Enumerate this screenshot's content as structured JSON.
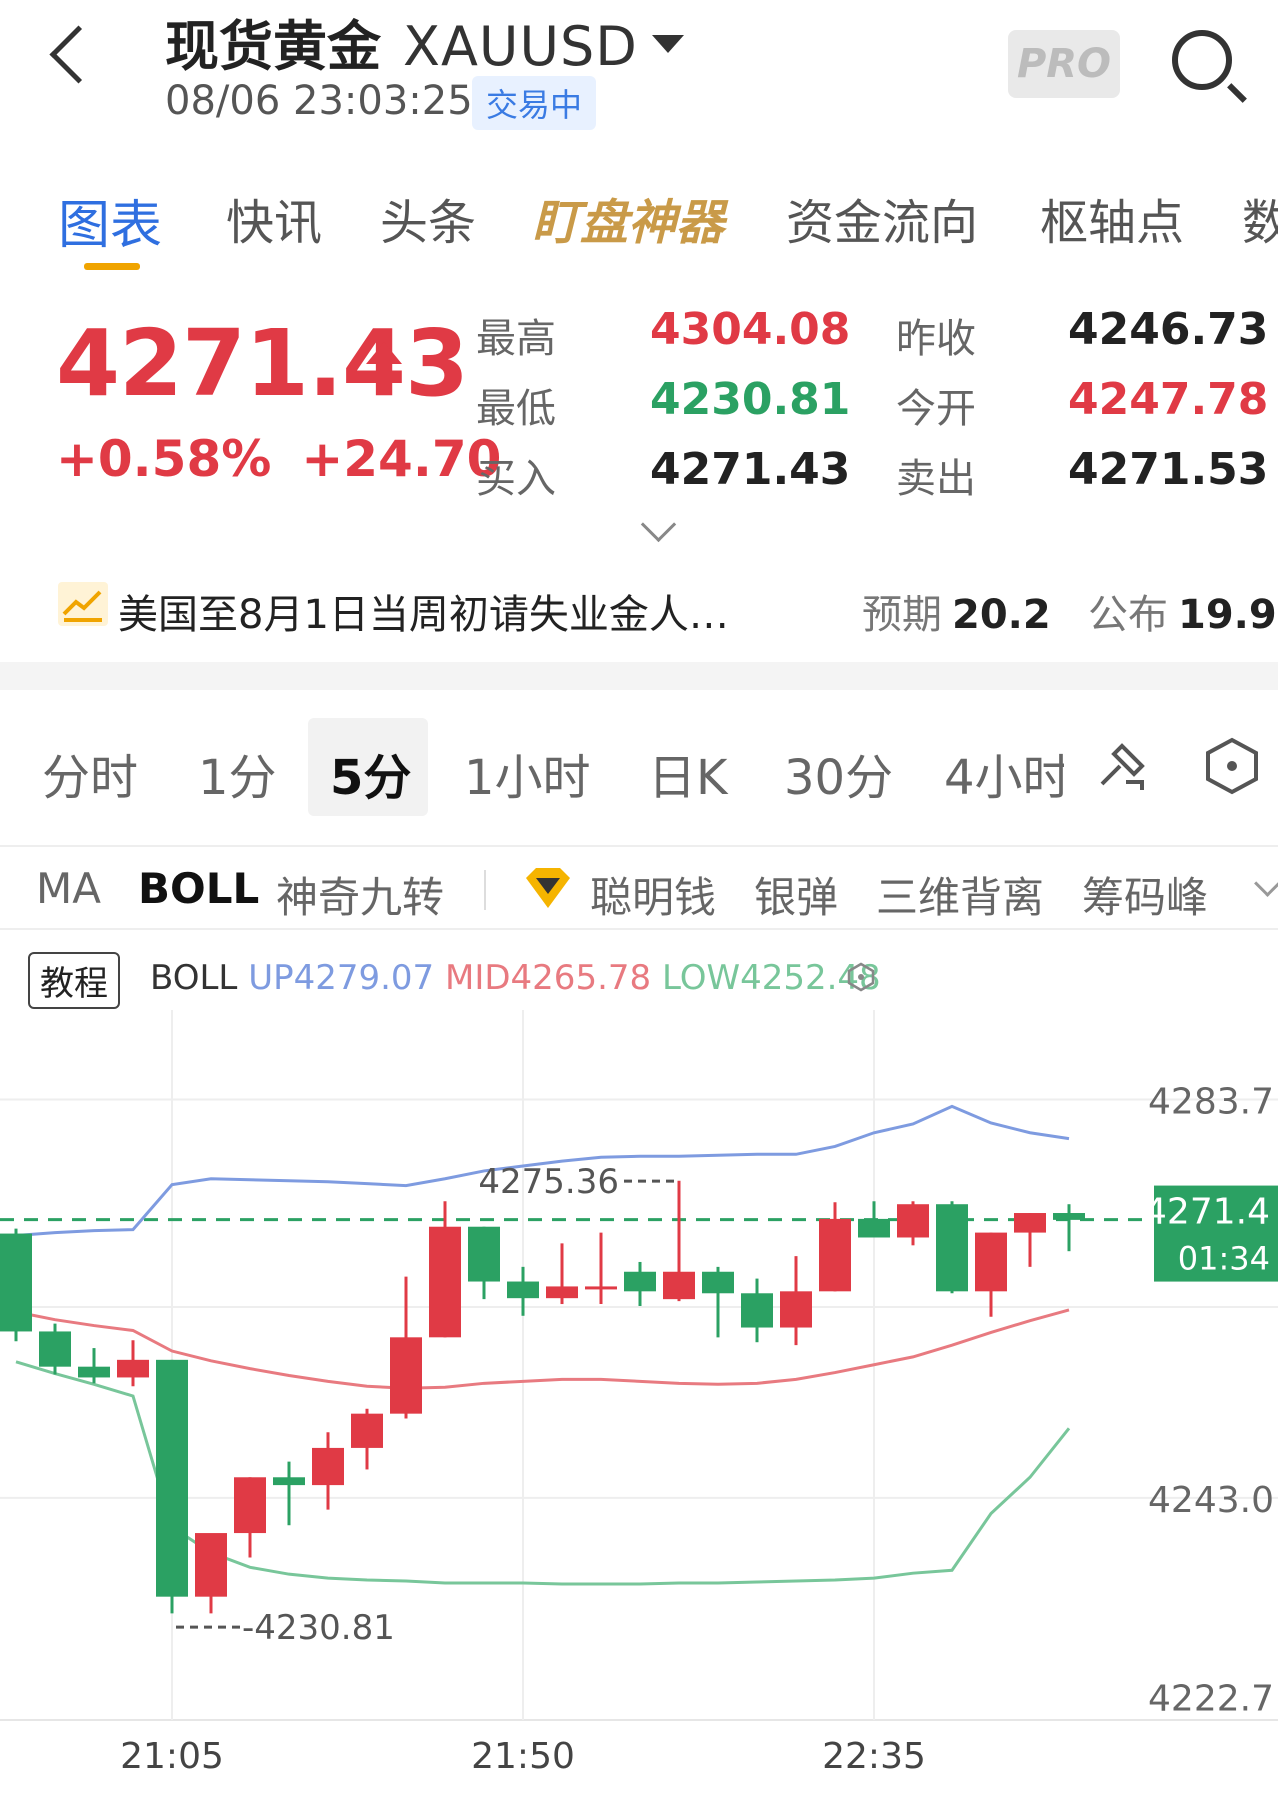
{
  "header": {
    "title": "现货黄金",
    "code": "XAUUSD",
    "datetime": "08/06 23:03:25",
    "status": "交易中",
    "pro_label": "PRO"
  },
  "tabs": [
    {
      "label": "图表",
      "active": true
    },
    {
      "label": "快讯"
    },
    {
      "label": "头条"
    },
    {
      "label": "盯盘神器",
      "special": true
    },
    {
      "label": "资金流向"
    },
    {
      "label": "枢轴点"
    },
    {
      "label": "数"
    }
  ],
  "quote": {
    "price": "4271.43",
    "change_pct": "+0.58%",
    "change_abs": "+24.70",
    "high_label": "最高",
    "high": "4304.08",
    "low_label": "最低",
    "low": "4230.81",
    "bid_label": "买入",
    "bid": "4271.43",
    "prev_close_label": "昨收",
    "prev_close": "4246.73",
    "open_label": "今开",
    "open": "4247.78",
    "ask_label": "卖出",
    "ask": "4271.53"
  },
  "news": {
    "text": "美国至8月1日当周初请失业金人…",
    "forecast_label": "预期",
    "forecast": "20.2",
    "actual_label": "公布",
    "actual": "19.9"
  },
  "periods": [
    {
      "label": "分时"
    },
    {
      "label": "1分"
    },
    {
      "label": "5分",
      "selected": true
    },
    {
      "label": "1小时"
    },
    {
      "label": "日K"
    },
    {
      "label": "30分"
    },
    {
      "label": "4小时"
    }
  ],
  "indicators": [
    {
      "label": "MA"
    },
    {
      "label": "BOLL",
      "selected": true
    },
    {
      "label": "神奇九转"
    },
    {
      "label": "聪明钱"
    },
    {
      "label": "银弹"
    },
    {
      "label": "三维背离"
    },
    {
      "label": "筹码峰"
    }
  ],
  "tutorial_label": "教程",
  "boll": {
    "name": "BOLL",
    "up": "UP4279.07",
    "mid": "MID4265.78",
    "low": "LOW4252.48"
  },
  "colors": {
    "up": "#e03a45",
    "down": "#2ba163",
    "accent": "#2f6fe0",
    "gold": "#c99a48"
  },
  "chart_data": {
    "type": "candlestick",
    "y_ticks": [
      "4283.7",
      "4243.0",
      "4222.7"
    ],
    "ylim": [
      4222.7,
      4288.0
    ],
    "x_ticks": [
      "21:05",
      "21:50",
      "22:35"
    ],
    "x_tick_index": [
      4,
      13,
      22
    ],
    "high_label": "4275.36",
    "low_label": "-4230.81",
    "current_price_label": "4271.4",
    "countdown": "01:34",
    "current_price": 4271.43,
    "candles": [
      {
        "o": 4270.0,
        "h": 4270.5,
        "l": 4259.0,
        "c": 4260.0
      },
      {
        "o": 4260.0,
        "h": 4260.8,
        "l": 4255.6,
        "c": 4256.4
      },
      {
        "o": 4256.4,
        "h": 4258.3,
        "l": 4254.7,
        "c": 4255.3
      },
      {
        "o": 4255.3,
        "h": 4259.1,
        "l": 4254.4,
        "c": 4257.1
      },
      {
        "o": 4257.1,
        "h": 4257.1,
        "l": 4231.2,
        "c": 4232.9
      },
      {
        "o": 4232.9,
        "h": 4237.8,
        "l": 4231.2,
        "c": 4239.4
      },
      {
        "o": 4239.4,
        "h": 4245.1,
        "l": 4236.9,
        "c": 4245.1
      },
      {
        "o": 4245.1,
        "h": 4246.7,
        "l": 4240.2,
        "c": 4244.3
      },
      {
        "o": 4244.3,
        "h": 4249.7,
        "l": 4241.8,
        "c": 4248.1
      },
      {
        "o": 4248.1,
        "h": 4252.1,
        "l": 4245.9,
        "c": 4251.6
      },
      {
        "o": 4251.6,
        "h": 4265.6,
        "l": 4251.1,
        "c": 4259.4
      },
      {
        "o": 4259.4,
        "h": 4273.3,
        "l": 4259.4,
        "c": 4270.7
      },
      {
        "o": 4270.7,
        "h": 4270.7,
        "l": 4263.3,
        "c": 4265.1
      },
      {
        "o": 4265.1,
        "h": 4266.6,
        "l": 4261.6,
        "c": 4263.4
      },
      {
        "o": 4263.4,
        "h": 4269.0,
        "l": 4262.8,
        "c": 4264.6
      },
      {
        "o": 4264.4,
        "h": 4270.1,
        "l": 4262.8,
        "c": 4264.6
      },
      {
        "o": 4266.1,
        "h": 4267.1,
        "l": 4262.6,
        "c": 4264.1
      },
      {
        "o": 4263.3,
        "h": 4275.4,
        "l": 4263.1,
        "c": 4266.1
      },
      {
        "o": 4266.1,
        "h": 4266.6,
        "l": 4259.4,
        "c": 4263.9
      },
      {
        "o": 4263.9,
        "h": 4265.4,
        "l": 4258.9,
        "c": 4260.4
      },
      {
        "o": 4260.4,
        "h": 4267.7,
        "l": 4258.6,
        "c": 4264.1
      },
      {
        "o": 4264.1,
        "h": 4273.2,
        "l": 4264.1,
        "c": 4271.5
      },
      {
        "o": 4271.5,
        "h": 4273.3,
        "l": 4269.8,
        "c": 4269.6
      },
      {
        "o": 4269.6,
        "h": 4273.3,
        "l": 4268.8,
        "c": 4273.0
      },
      {
        "o": 4273.0,
        "h": 4273.3,
        "l": 4263.9,
        "c": 4264.1
      },
      {
        "o": 4264.1,
        "h": 4270.1,
        "l": 4261.5,
        "c": 4270.1
      },
      {
        "o": 4270.1,
        "h": 4272.1,
        "l": 4266.6,
        "c": 4272.1
      },
      {
        "o": 4272.1,
        "h": 4273.0,
        "l": 4268.2,
        "c": 4271.4
      }
    ],
    "series": [
      {
        "name": "UP",
        "values": [
          4269.8,
          4270.1,
          4270.3,
          4270.4,
          4275.0,
          4275.6,
          4275.5,
          4275.4,
          4275.3,
          4275.1,
          4274.9,
          4275.6,
          4276.4,
          4276.9,
          4277.4,
          4277.8,
          4277.9,
          4277.9,
          4278.0,
          4278.1,
          4278.1,
          4278.9,
          4280.3,
          4281.2,
          4283.0,
          4281.3,
          4280.3,
          4279.7
        ]
      },
      {
        "name": "MID",
        "values": [
          4262.0,
          4261.2,
          4260.6,
          4260.1,
          4258.0,
          4257.0,
          4256.2,
          4255.5,
          4254.9,
          4254.4,
          4254.2,
          4254.3,
          4254.7,
          4254.9,
          4255.1,
          4255.1,
          4254.9,
          4254.7,
          4254.6,
          4254.7,
          4255.1,
          4255.8,
          4256.6,
          4257.4,
          4258.6,
          4259.9,
          4261.1,
          4262.2
        ]
      },
      {
        "name": "LOW",
        "values": [
          4256.9,
          4255.7,
          4254.6,
          4253.4,
          4240.0,
          4237.4,
          4235.9,
          4235.2,
          4234.8,
          4234.6,
          4234.5,
          4234.3,
          4234.3,
          4234.3,
          4234.2,
          4234.2,
          4234.2,
          4234.3,
          4234.3,
          4234.4,
          4234.5,
          4234.6,
          4234.8,
          4235.3,
          4235.6,
          4241.4,
          4245.1,
          4250.1
        ]
      }
    ]
  }
}
